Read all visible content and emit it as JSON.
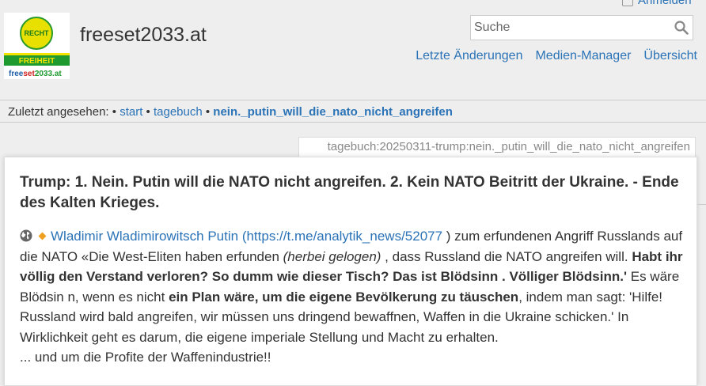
{
  "header": {
    "login_label": "Anmelden",
    "site_title": "freeset2033.at",
    "logo": {
      "top_text": "RECHT",
      "bar_text": "FREIHEIT",
      "domain_part1": "free",
      "domain_part2": "set",
      "domain_part3": "2033.at"
    },
    "search": {
      "placeholder": "Suche",
      "value": ""
    },
    "toolbar": [
      "Letzte Änderungen",
      "Medien-Manager",
      "Übersicht"
    ]
  },
  "breadcrumbs": {
    "label": "Zuletzt angesehen:",
    "items": [
      "start",
      "tagebuch"
    ],
    "current": "nein._putin_will_die_nato_nicht_angreifen"
  },
  "page_id": "tagebuch:20250311-trump:nein._putin_will_die_nato_nicht_angreifen",
  "article": {
    "title": "Trump: 1. Nein. Putin will die NATO nicht angreifen. 2. Kein NATO Beitritt der Ukraine. - Ende des Kalten Krieges.",
    "link_text": "Wladimir Wladimirowitsch Putin (https://t.me/analytik_news/52077",
    "t1": " ) zum erfundenen Angriff Russlands auf die NATO «Die West-Eliten haben erfunden ",
    "t1_em": "(herbei gelogen)",
    "t2": " , dass Russland die NATO angreifen will. ",
    "t2_bold": "Habt ihr völlig den Verstand verloren? So dumm wie dieser Tisch? Das ist Blödsinn . Völliger Blödsinn.'",
    "t3": " Es wäre Blödsin n, wenn es nicht ",
    "t3_bold": "ein Plan wäre, um die eigene Bevölkerung zu täuschen",
    "t4": ", indem man sagt: 'Hilfe! Russland wird bald angreifen, wir müssen uns dringend bewaffnen, Waffen in die Ukraine schicken.' In Wirklichkeit geht es darum, die eigene imperiale Stellung und Macht zu erhalten.",
    "t5": "... und um die Profite der Waffenindustrie!!"
  },
  "colors": {
    "link": "#2b73b7",
    "background": "#eeeeee",
    "text": "#333333"
  }
}
